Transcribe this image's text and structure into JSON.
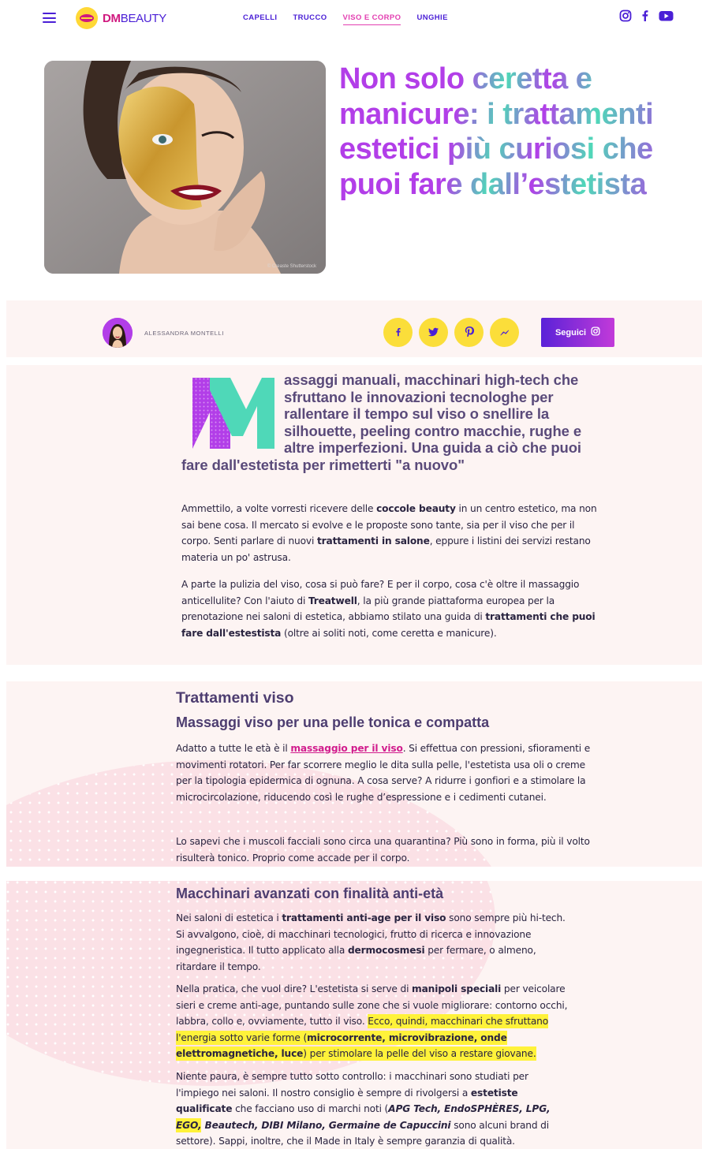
{
  "header": {
    "logo_dm": "DM",
    "logo_beauty": "BEAUTY",
    "nav": [
      "CAPELLI",
      "TRUCCO",
      "VISO E CORPO",
      "UNGHIE"
    ],
    "active_nav": "VISO E CORPO",
    "social_icons": [
      "instagram-icon",
      "facebook-icon",
      "youtube-icon"
    ]
  },
  "hero": {
    "title": "Non solo ceretta e manicure: i trattamenti estetici più curiosi che puoi fare dall’estetista",
    "image_credit": "© Creaste Shutterstock"
  },
  "author": {
    "name": "ALESSANDRA MONTELLI",
    "share_icons": [
      "facebook-icon",
      "twitter-icon",
      "pinterest-icon",
      "messenger-icon"
    ],
    "follow_label": "Seguici"
  },
  "intro": {
    "dropcap": "M",
    "lead": "assaggi manuali, macchinari high-tech che sfruttano le innovazioni tecnologhe per rallentare il tempo sul viso o snellire la silhouette, peeling contro macchie, rughe e altre imperfezioni. Una guida a ciò che puoi fare dall'estetista per rimetterti \"a nuovo\"",
    "p1": [
      "Ammettilo, a volte vorresti ricevere delle ",
      "coccole beauty",
      " in un centro estetico, ma non sai bene cosa. Il mercato si evolve e le proposte sono tante, sia per il viso che per il corpo. Senti parlare di nuovi ",
      "trattamenti in salone",
      ", eppure i listini dei servizi restano materia un po' astrusa."
    ],
    "p2": [
      "A parte la pulizia del viso, cosa si può fare? E per il corpo, cosa c'è oltre il massaggio anticellulite? Con l'aiuto di ",
      "Treatwell",
      ", la più grande piattaforma europea per la prenotazione nei saloni di estetica, abbiamo stilato una guida di ",
      "trattamenti che puoi fare dall'estestista",
      " (oltre ai soliti noti, come ceretta e manicure)."
    ]
  },
  "section_viso": {
    "heading": "Trattamenti viso",
    "subheading": "Massaggi viso per una pelle tonica e compatta",
    "p1": [
      "Adatto a tutte le età è il ",
      "massaggio per il viso",
      ". Si effettua con pressioni, sfioramenti e movimenti rotatori. Per far scorrere meglio le dita sulla pelle, l'estetista usa oli o creme per la tipologia epidermica di ognuna. A cosa serve? A ridurre i gonfiori e a stimolare la microcircolazione, riducendo così le rughe d’espressione e i cedimenti cutanei."
    ],
    "p2": "Lo sapevi che i muscoli facciali sono circa una quarantina? Più sono in forma, più il volto risulterà tonico. Proprio come accade per il corpo."
  },
  "section_macchinari": {
    "heading": "Macchinari avanzati con finalità anti-età",
    "p1": [
      "Nei saloni di estetica i ",
      "trattamenti anti-age per il viso",
      " sono sempre più hi-tech. Si avvalgono, cioè, di macchinari tecnologici, frutto di ricerca e innovazione ingegneristica. Il tutto applicato alla ",
      "dermocosmesi",
      " per fermare, o almeno, ritardare il tempo."
    ],
    "p2": [
      "Nella pratica, che vuol dire? L'estetista si serve di ",
      "manipoli speciali",
      " per veicolare sieri e creme anti-age, puntando sulle zone che si vuole migliorare: contorno occhi, labbra, collo e, ovviamente, tutto il viso. ",
      "Ecco, quindi, macchinari che sfruttano l'energia sotto varie forme (",
      "microcorrente, microvibrazione, onde elettromagnetiche, luce",
      ") per stimolare la pelle del viso a restare giovane."
    ],
    "p3": [
      "Niente paura, è sempre tutto sotto controllo: i macchinari sono studiati per l'impiego nei saloni. Il nostro consiglio è sempre di rivolgersi a ",
      "estetiste qualificate",
      " che facciano uso di marchi noti (",
      "APG Tech, EndoSPHÈRES, LPG, ",
      "EGO,",
      " Beautech, DIBI Milano, Germaine de Capuccini",
      " sono alcuni brand di settore). Sappi, inoltre, che il Made in Italy è sempre garanzia di qualità."
    ]
  },
  "colors": {
    "brand_purple": "#4a1fd6",
    "brand_pink": "#d0197f",
    "title_purple": "#b23ee8",
    "title_teal": "#4fd8b8",
    "share_yellow": "#fbde3a",
    "highlight_yellow": "#fff23a",
    "section_bg": "#fdf4f3"
  }
}
